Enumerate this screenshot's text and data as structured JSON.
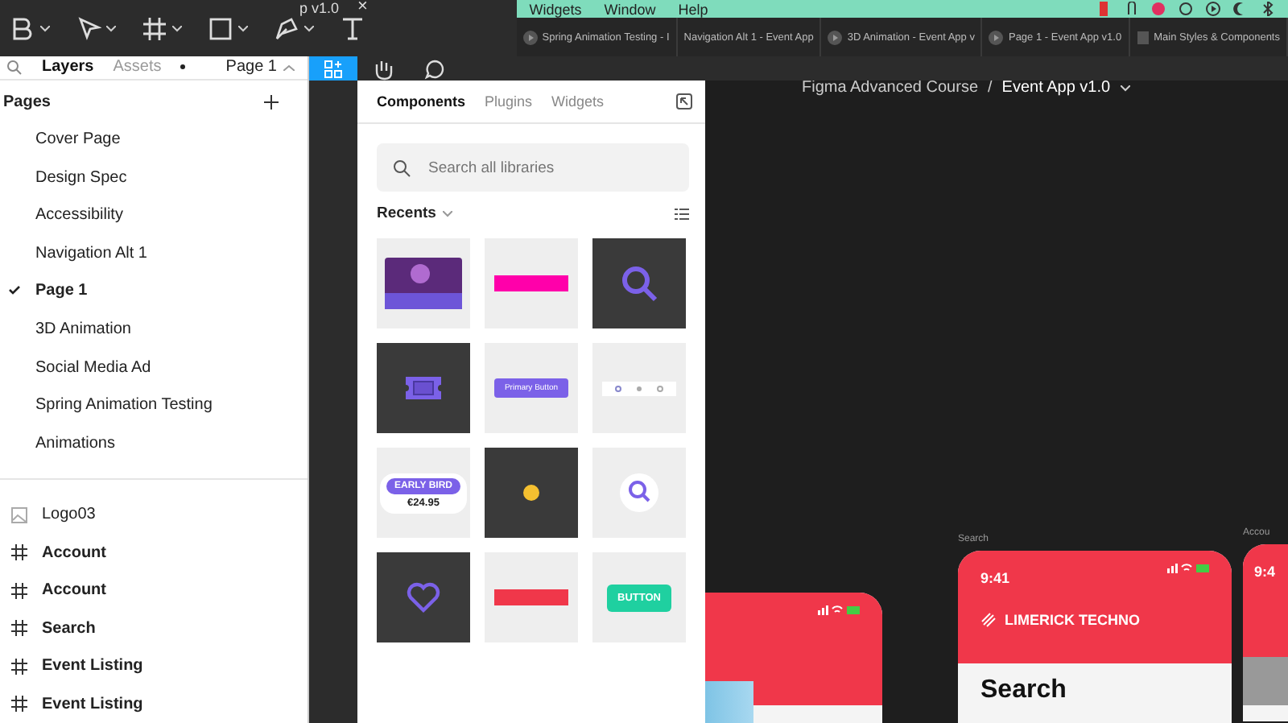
{
  "toolbar": {
    "file_title": "p v1.0",
    "close": "×"
  },
  "menu_bar": {
    "items": [
      "Widgets",
      "Window",
      "Help"
    ]
  },
  "browser_tabs": [
    {
      "label": "Spring Animation Testing - I",
      "kind": "video",
      "selected": false
    },
    {
      "label": "Navigation Alt 1 - Event App",
      "kind": "plain",
      "selected": false
    },
    {
      "label": "3D Animation - Event App v",
      "kind": "video",
      "selected": false
    },
    {
      "label": "Page 1 - Event App v1.0",
      "kind": "video",
      "selected": false
    },
    {
      "label": "Main Styles & Components",
      "kind": "file",
      "selected": false
    }
  ],
  "breadcrumb": {
    "project": "Figma Advanced Course",
    "separator": "/",
    "file": "Event App v1.0"
  },
  "left_panel": {
    "tabs": [
      {
        "label": "Layers",
        "selected": true
      },
      {
        "label": "Assets",
        "selected": false
      }
    ],
    "page_selector": "Page 1",
    "pages_heading": "Pages",
    "pages": [
      {
        "name": "Cover Page",
        "selected": false
      },
      {
        "name": "Design Spec",
        "selected": false
      },
      {
        "name": "Accessibility",
        "selected": false
      },
      {
        "name": "Navigation Alt 1",
        "selected": false
      },
      {
        "name": "Page 1",
        "selected": true
      },
      {
        "name": "3D Animation",
        "selected": false
      },
      {
        "name": "Social Media Ad",
        "selected": false
      },
      {
        "name": "Spring Animation Testing",
        "selected": false
      },
      {
        "name": "Animations",
        "selected": false
      }
    ],
    "layers": [
      {
        "name": "Logo03",
        "kind": "image"
      },
      {
        "name": "Account",
        "kind": "frame"
      },
      {
        "name": "Account",
        "kind": "frame"
      },
      {
        "name": "Search",
        "kind": "frame"
      },
      {
        "name": "Event Listing",
        "kind": "frame"
      },
      {
        "name": "Event Listing",
        "kind": "frame"
      }
    ]
  },
  "assets_panel": {
    "tabs": [
      {
        "label": "Components",
        "selected": true
      },
      {
        "label": "Plugins",
        "selected": false
      },
      {
        "label": "Widgets",
        "selected": false
      }
    ],
    "search": {
      "placeholder": "Search all libraries"
    },
    "section": "Recents",
    "components": [
      {
        "kind": "photo-card"
      },
      {
        "kind": "pink-bar"
      },
      {
        "kind": "search-dark"
      },
      {
        "kind": "ticket-dark"
      },
      {
        "kind": "pill-button",
        "label": "Primary Button"
      },
      {
        "kind": "nav-bar"
      },
      {
        "kind": "price-tag",
        "label": "EARLY BIRD",
        "price": "€24.95"
      },
      {
        "kind": "emoji-dark"
      },
      {
        "kind": "search-light"
      },
      {
        "kind": "heart-dark"
      },
      {
        "kind": "red-bar"
      },
      {
        "kind": "green-button",
        "label": "BUTTON"
      }
    ]
  },
  "canvas": {
    "frames": [
      {
        "kind": "image"
      },
      {
        "kind": "search",
        "label": "Search",
        "time": "9:41",
        "title": "LIMERICK TECHNO",
        "heading": "Search"
      },
      {
        "kind": "partial",
        "label": "Accou",
        "time": "9:4"
      }
    ]
  }
}
